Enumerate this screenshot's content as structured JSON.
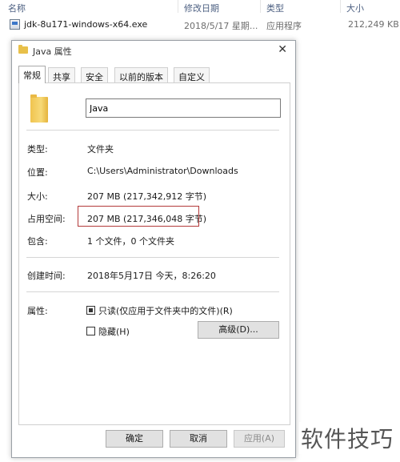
{
  "explorer": {
    "columns": [
      "名称",
      "修改日期",
      "类型",
      "大小"
    ],
    "file": {
      "name": "jdk-8u171-windows-x64.exe",
      "modified": "2018/5/17 星期...",
      "type": "应用程序",
      "size": "212,249 KB"
    }
  },
  "dialog": {
    "title": "Java 属性",
    "close_glyph": "✕",
    "tabs": [
      "常规",
      "共享",
      "安全",
      "以前的版本",
      "自定义"
    ],
    "active_tab": "常规",
    "folder_name": "Java",
    "fields": [
      {
        "label": "类型:",
        "value": "文件夹"
      },
      {
        "label": "位置:",
        "value": "C:\\Users\\Administrator\\Downloads"
      },
      {
        "label": "大小:",
        "value": "207 MB (217,342,912 字节)"
      },
      {
        "label": "占用空间:",
        "value": "207 MB (217,346,048 字节)"
      },
      {
        "label": "包含:",
        "value": "1 个文件，0 个文件夹"
      },
      {
        "label": "创建时间:",
        "value": "2018年5月17日 今天，8:26:20"
      },
      {
        "label": "属性:"
      }
    ],
    "attributes": {
      "readonly_label": "只读(仅应用于文件夹中的文件)(R)",
      "readonly_checked": true,
      "hidden_label": "隐藏(H)",
      "hidden_checked": false,
      "advanced_label": "高级(D)..."
    },
    "buttons": {
      "ok": "确定",
      "cancel": "取消",
      "apply": "应用(A)"
    },
    "highlight_color": "#b33a3a"
  },
  "watermark": "软件技巧"
}
